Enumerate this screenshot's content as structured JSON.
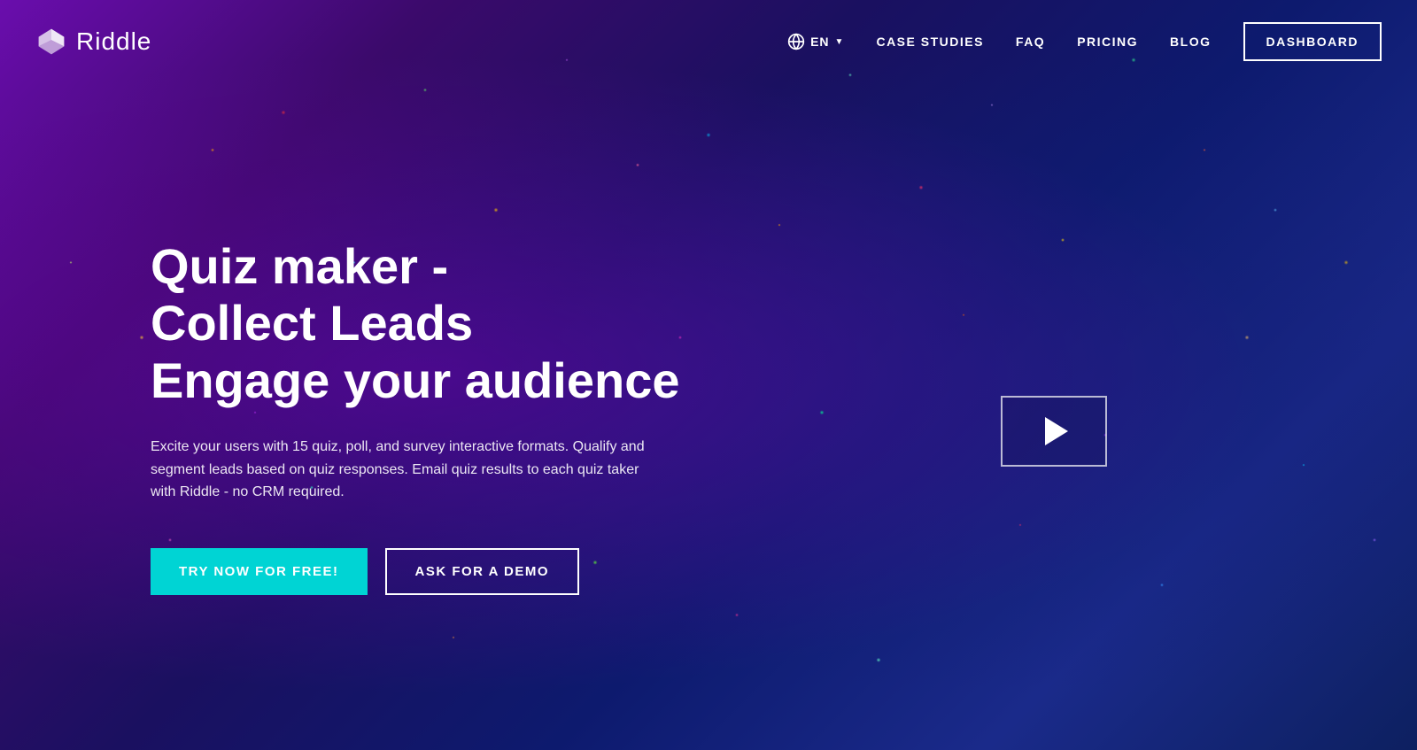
{
  "brand": {
    "name": "Riddle",
    "logo_alt": "Riddle logo"
  },
  "navbar": {
    "lang_label": "EN",
    "links": [
      {
        "id": "case-studies",
        "label": "CASE STUDIES",
        "url": "#"
      },
      {
        "id": "faq",
        "label": "FAQ",
        "url": "#"
      },
      {
        "id": "pricing",
        "label": "PRICING",
        "url": "#"
      },
      {
        "id": "blog",
        "label": "BLOG",
        "url": "#"
      }
    ],
    "dashboard_label": "DASHBOARD"
  },
  "hero": {
    "title_line1": "Quiz maker -",
    "title_line2": "Collect Leads",
    "title_line3": "Engage your audience",
    "description": "Excite your users with 15 quiz, poll, and survey interactive formats. Qualify and segment leads based on quiz responses. Email quiz results to each quiz taker with Riddle - no CRM required.",
    "cta_primary": "TRY NOW FOR FREE!",
    "cta_secondary": "ASK FOR A DEMO"
  },
  "colors": {
    "primary_cyan": "#00d4d4",
    "nav_bg": "transparent",
    "hero_bg_start": "#6a0dad",
    "hero_bg_end": "#0d2060"
  }
}
